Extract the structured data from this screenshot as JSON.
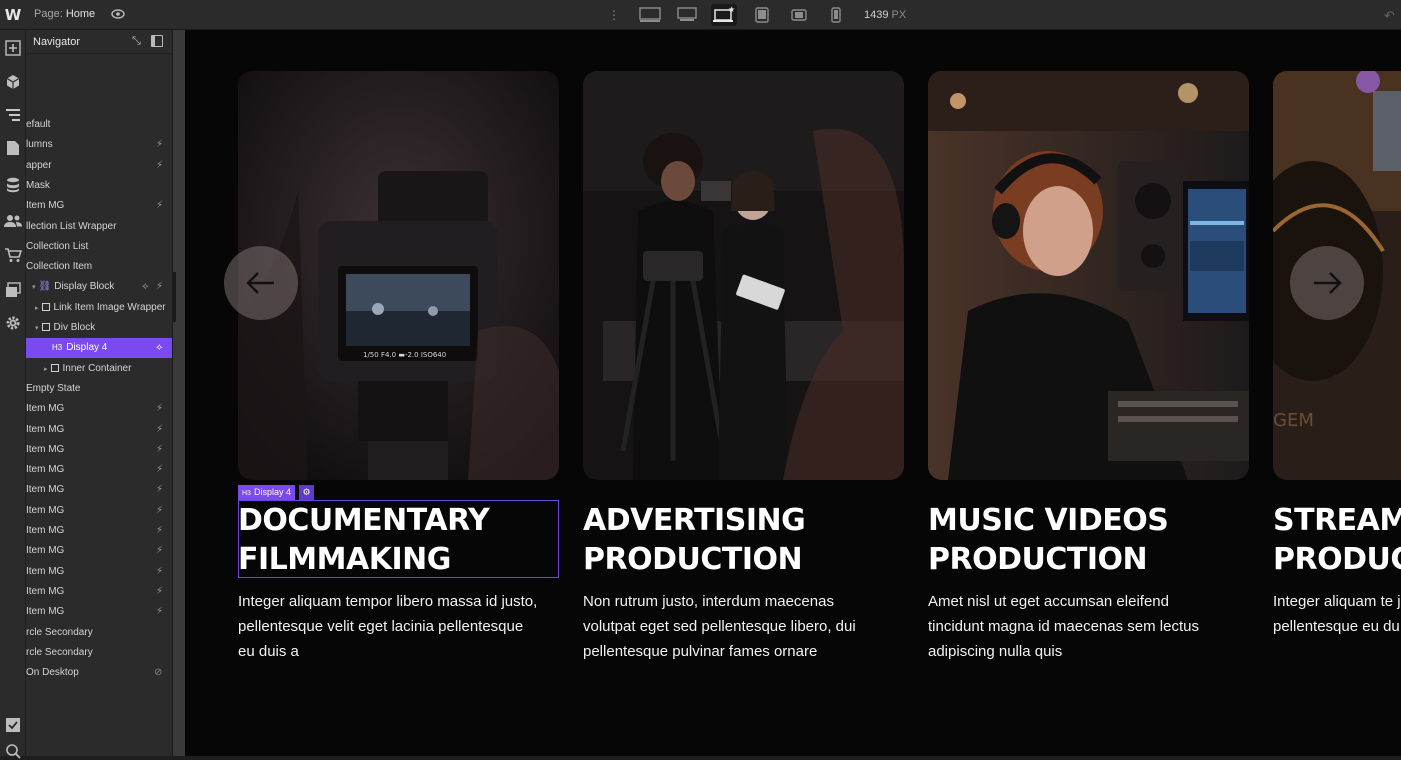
{
  "topbar": {
    "logo": "W",
    "page_prefix": "Page:",
    "page_name": "Home",
    "width_value": "1439",
    "width_unit": "PX"
  },
  "navigator": {
    "title": "Navigator",
    "items": [
      {
        "label": "efault",
        "indent": 0,
        "bolt": false,
        "selected": false
      },
      {
        "label": "lumns",
        "indent": 0,
        "bolt": true,
        "selected": false
      },
      {
        "label": "apper",
        "indent": 0,
        "bolt": true,
        "selected": false
      },
      {
        "label": "Mask",
        "indent": 0,
        "bolt": false,
        "selected": false
      },
      {
        "label": "Item MG",
        "indent": 0,
        "bolt": true,
        "selected": false
      },
      {
        "label": "llection List Wrapper",
        "indent": 0,
        "bolt": false,
        "selected": false
      },
      {
        "label": "Collection List",
        "indent": 0,
        "bolt": false,
        "selected": false
      },
      {
        "label": "Collection Item",
        "indent": 0,
        "bolt": false,
        "selected": false
      },
      {
        "label": "Display Block",
        "indent": 1,
        "bolt": true,
        "selected": false
      },
      {
        "label": "Link Item Image Wrapper",
        "indent": 2,
        "bolt": false,
        "selected": false
      },
      {
        "label": "Div Block",
        "indent": 2,
        "bolt": false,
        "selected": false
      },
      {
        "label": "Display 4",
        "indent": 3,
        "bolt": true,
        "selected": true
      },
      {
        "label": "Inner Container",
        "indent": 3,
        "bolt": false,
        "selected": false
      },
      {
        "label": "Empty State",
        "indent": 0,
        "bolt": false,
        "selected": false
      },
      {
        "label": "Item MG",
        "indent": 0,
        "bolt": true,
        "selected": false
      },
      {
        "label": "Item MG",
        "indent": 0,
        "bolt": true,
        "selected": false
      },
      {
        "label": "Item MG",
        "indent": 0,
        "bolt": true,
        "selected": false
      },
      {
        "label": "Item MG",
        "indent": 0,
        "bolt": true,
        "selected": false
      },
      {
        "label": "Item MG",
        "indent": 0,
        "bolt": true,
        "selected": false
      },
      {
        "label": "Item MG",
        "indent": 0,
        "bolt": true,
        "selected": false
      },
      {
        "label": "Item MG",
        "indent": 0,
        "bolt": true,
        "selected": false
      },
      {
        "label": "Item MG",
        "indent": 0,
        "bolt": true,
        "selected": false
      },
      {
        "label": "Item MG",
        "indent": 0,
        "bolt": true,
        "selected": false
      },
      {
        "label": "Item MG",
        "indent": 0,
        "bolt": true,
        "selected": false
      },
      {
        "label": "Item MG",
        "indent": 0,
        "bolt": true,
        "selected": false
      },
      {
        "label": "rcle Secondary",
        "indent": 0,
        "bolt": false,
        "selected": false
      },
      {
        "label": "rcle Secondary",
        "indent": 0,
        "bolt": false,
        "selected": false
      },
      {
        "label": "On Desktop",
        "indent": 0,
        "bolt": false,
        "selected": false
      }
    ]
  },
  "selection": {
    "badge_tag": "H3",
    "badge_label": "Display 4"
  },
  "cards": [
    {
      "title_line1": "DOCUMENTARY",
      "title_line2": "FILMMAKING",
      "text": "Integer aliquam tempor libero massa id justo, pellentesque velit eget lacinia pellentesque eu duis a"
    },
    {
      "title_line1": "ADVERTISING",
      "title_line2": "PRODUCTION",
      "text": "Non rutrum justo, interdum maecenas volutpat eget sed pellentesque libero, dui pellentesque pulvinar fames ornare"
    },
    {
      "title_line1": "MUSIC VIDEOS",
      "title_line2": "PRODUCTION",
      "text": "Amet nisl ut eget accumsan eleifend tincidunt magna id maecenas sem lectus adipiscing nulla quis"
    },
    {
      "title_line1": "STREAM",
      "title_line2": "PRODUC",
      "text": "Integer aliquam te justo, pellentesque pellentesque eu du"
    }
  ],
  "colors": {
    "accent": "#7b49f0",
    "canvas_bg": "#070607",
    "panel_bg": "#2b2b2b"
  }
}
